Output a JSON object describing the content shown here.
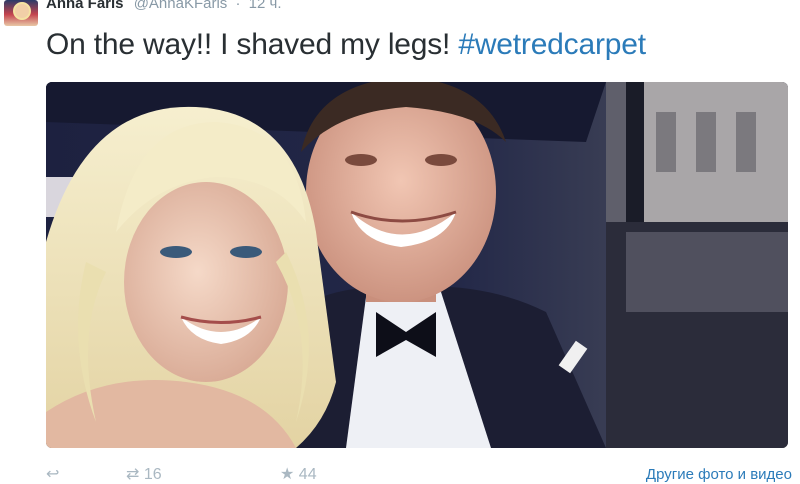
{
  "tweet": {
    "author_name": "Anna Faris",
    "author_handle": "@AnnaKFaris",
    "separator": "·",
    "timestamp": "12 ч.",
    "text_main": "On the way!! I shaved my legs! ",
    "hashtag": "#wetredcarpet"
  },
  "actions": {
    "reply_icon": "reply-icon",
    "retweet_icon": "retweet-icon",
    "retweet_count": "16",
    "favorite_icon": "star-icon",
    "favorite_count": "44",
    "more_link": "Другие фото и видео"
  },
  "colors": {
    "text": "#292f33",
    "muted": "#8899a6",
    "link": "#2b7bb9"
  }
}
